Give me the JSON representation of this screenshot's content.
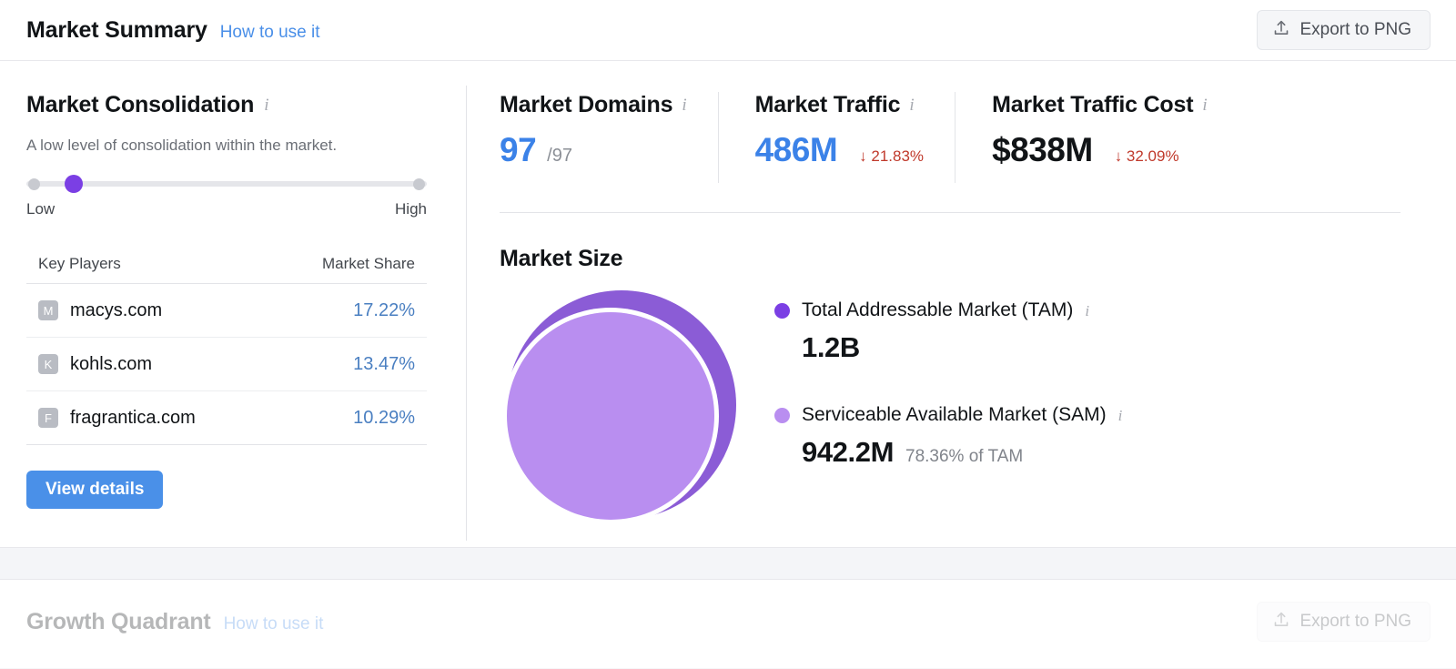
{
  "header": {
    "title": "Market Summary",
    "how_to_use": "How to use it",
    "export_label": "Export to PNG"
  },
  "consolidation": {
    "title": "Market Consolidation",
    "description": "A low level of consolidation within the market.",
    "slider": {
      "low_label": "Low",
      "high_label": "High",
      "value_percent": 9
    },
    "table": {
      "col_players": "Key Players",
      "col_share": "Market Share",
      "rows": [
        {
          "initial": "M",
          "domain": "macys.com",
          "share": "17.22%"
        },
        {
          "initial": "K",
          "domain": "kohls.com",
          "share": "13.47%"
        },
        {
          "initial": "F",
          "domain": "fragrantica.com",
          "share": "10.29%"
        }
      ]
    },
    "view_details": "View details"
  },
  "metrics": [
    {
      "name": "Market Domains",
      "value": "97",
      "suffix": "/97",
      "delta": "",
      "value_color": "blue"
    },
    {
      "name": "Market Traffic",
      "value": "486M",
      "suffix": "",
      "delta": "↓ 21.83%",
      "value_color": "blue"
    },
    {
      "name": "Market Traffic Cost",
      "value": "$838M",
      "suffix": "",
      "delta": "↓ 32.09%",
      "value_color": "black"
    }
  ],
  "market_size": {
    "title": "Market Size",
    "tam": {
      "label": "Total Addressable Market (TAM)",
      "value": "1.2B",
      "sub": "",
      "color": "#7b3fe4"
    },
    "sam": {
      "label": "Serviceable Available Market (SAM)",
      "value": "942.2M",
      "sub": "78.36% of TAM",
      "color": "#b98ef0"
    }
  },
  "footer": {
    "title": "Growth Quadrant",
    "how_to_use": "How to use it",
    "export_label": "Export to PNG"
  },
  "chart_data": {
    "type": "pie",
    "title": "Market Size",
    "categories": [
      "Total Addressable Market (TAM)",
      "Serviceable Available Market (SAM)"
    ],
    "values": [
      1200000000,
      942200000
    ],
    "value_labels": [
      "1.2B",
      "942.2M"
    ],
    "ratio_label": "78.36% of TAM",
    "colors": [
      "#8b5cd6",
      "#b98ef0"
    ],
    "legend": "right",
    "grid": false
  }
}
